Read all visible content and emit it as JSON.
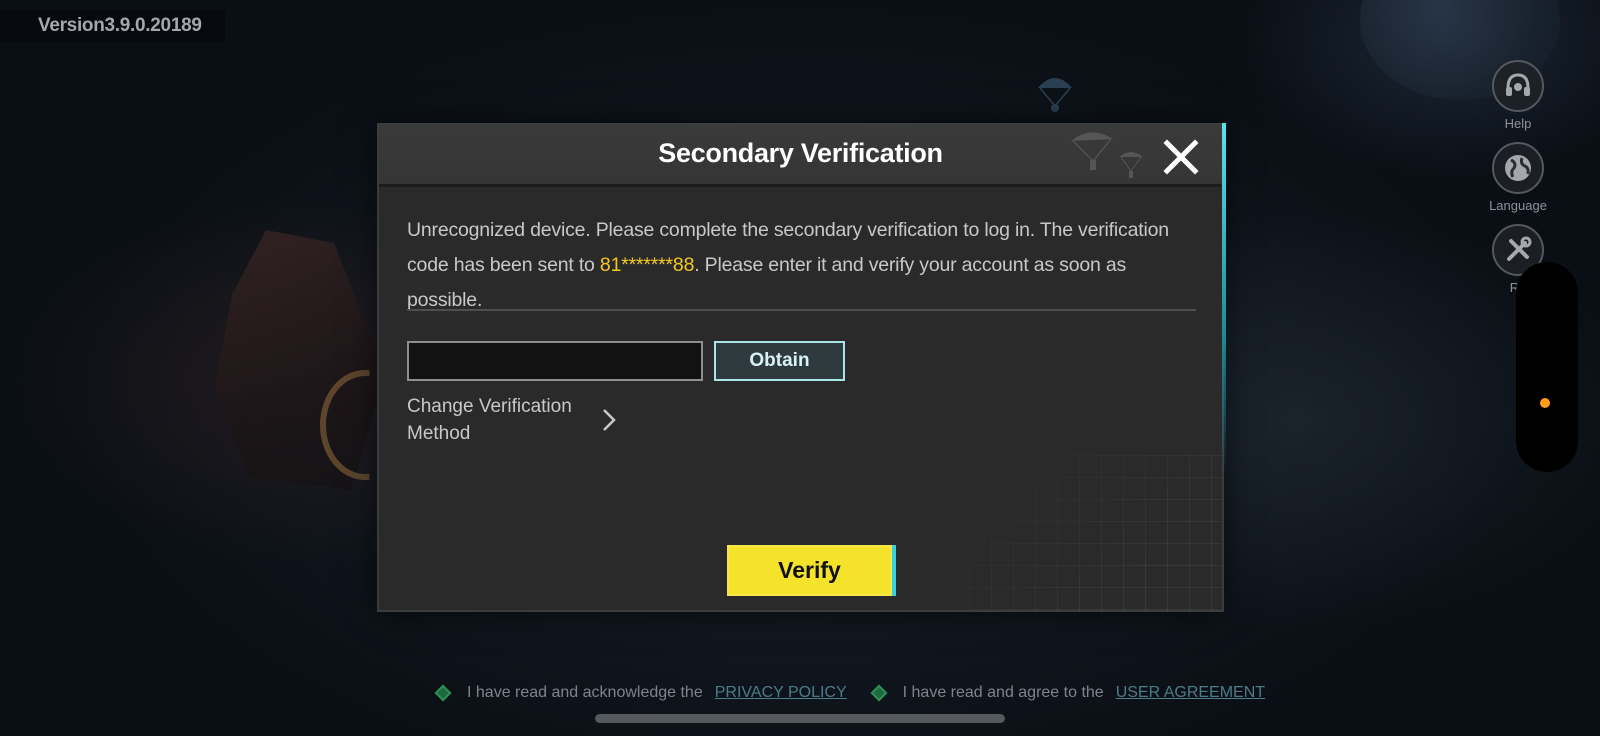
{
  "version": "Version3.9.0.20189",
  "side_buttons": [
    {
      "label": "Help",
      "icon": "help-headset-icon"
    },
    {
      "label": "Language",
      "icon": "globe-icon"
    },
    {
      "label": "Re",
      "icon": "repair-tools-icon"
    }
  ],
  "dialog": {
    "title": "Secondary Verification",
    "message_before": "Unrecognized device. Please complete the secondary verification to log in. The verification code has been sent to ",
    "masked_number": "81*******88",
    "message_after": ". Please enter it and verify your account as soon as possible.",
    "code_input_value": "",
    "obtain_label": "Obtain",
    "change_method_label": "Change Verification Method",
    "verify_label": "Verify"
  },
  "footer": {
    "privacy_prefix": "I have read and acknowledge the",
    "privacy_link": "PRIVACY POLICY",
    "agreement_prefix": "I have read and agree to the",
    "agreement_link": "USER AGREEMENT"
  },
  "colors": {
    "accent_yellow": "#f5e22a",
    "highlight_number": "#f4c821",
    "obtain_border": "#a9e5e8",
    "status_dot": "#ff9d1a"
  }
}
